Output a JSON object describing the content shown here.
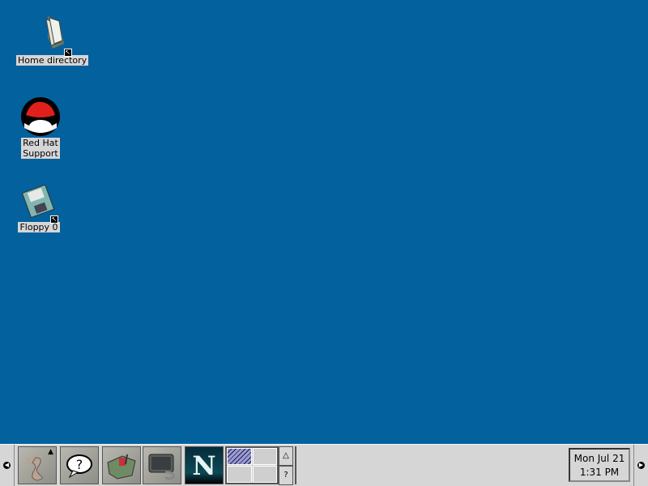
{
  "desktop": {
    "background": "#03619e",
    "icons": [
      {
        "label": "Home directory",
        "icon": "folder-icon",
        "shortcut": true
      },
      {
        "label": "Red Hat\nSupport",
        "icon": "redhat-icon",
        "shortcut": false
      },
      {
        "label": "Floppy 0",
        "icon": "floppy-icon",
        "shortcut": true
      }
    ]
  },
  "panel": {
    "launchers": [
      {
        "name": "gnome-menu",
        "icon": "gnome-foot-icon"
      },
      {
        "name": "help",
        "icon": "help-icon"
      },
      {
        "name": "control-center",
        "icon": "toolbox-icon"
      },
      {
        "name": "terminal",
        "icon": "terminal-icon"
      },
      {
        "name": "netscape",
        "icon": "netscape-icon",
        "glyph": "N"
      }
    ],
    "pager": {
      "workspaces": 4,
      "active": 1,
      "help_label": "?",
      "up_label": "△"
    },
    "clock": {
      "date": "Mon Jul 21",
      "time": "1:31 PM"
    }
  }
}
